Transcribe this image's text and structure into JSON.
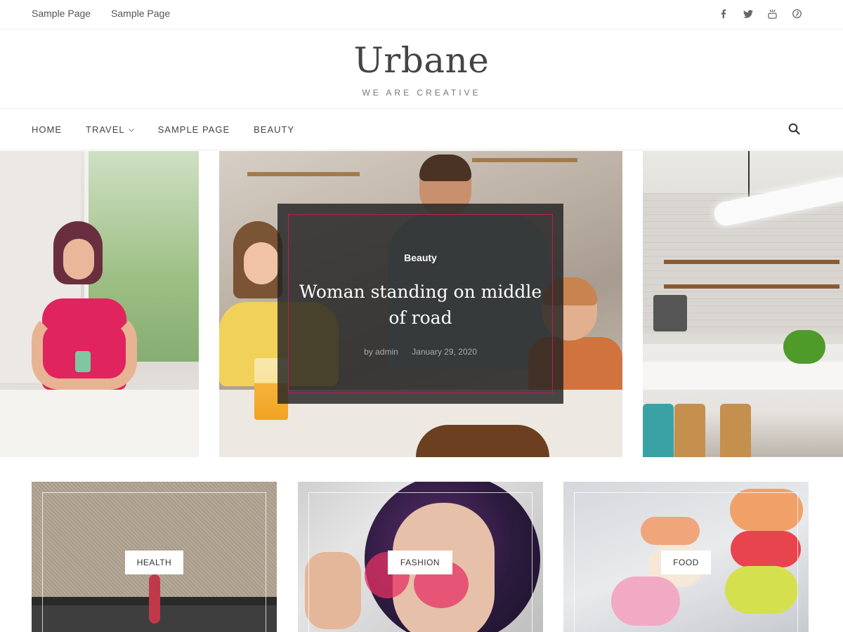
{
  "topbar": {
    "links": [
      "Sample Page",
      "Sample Page"
    ],
    "social_icons": [
      "facebook-icon",
      "twitter-icon",
      "youtube-icon",
      "pinterest-icon"
    ]
  },
  "branding": {
    "site_title": "Urbane",
    "tagline": "WE ARE CREATIVE"
  },
  "nav": {
    "items": [
      "HOME",
      "TRAVEL",
      "SAMPLE PAGE",
      "BEAUTY"
    ],
    "dropdown_item_index": 1,
    "search_icon": "search-icon"
  },
  "featured": {
    "category": "Beauty",
    "title": "Woman standing on middle of road",
    "author": "by admin",
    "date": "January 29, 2020"
  },
  "categories": [
    {
      "label": "HEALTH"
    },
    {
      "label": "FASHION"
    },
    {
      "label": "FOOD"
    }
  ],
  "colors": {
    "accent_frame": "#c2185b",
    "overlay": "#222222",
    "text": "#444444"
  }
}
